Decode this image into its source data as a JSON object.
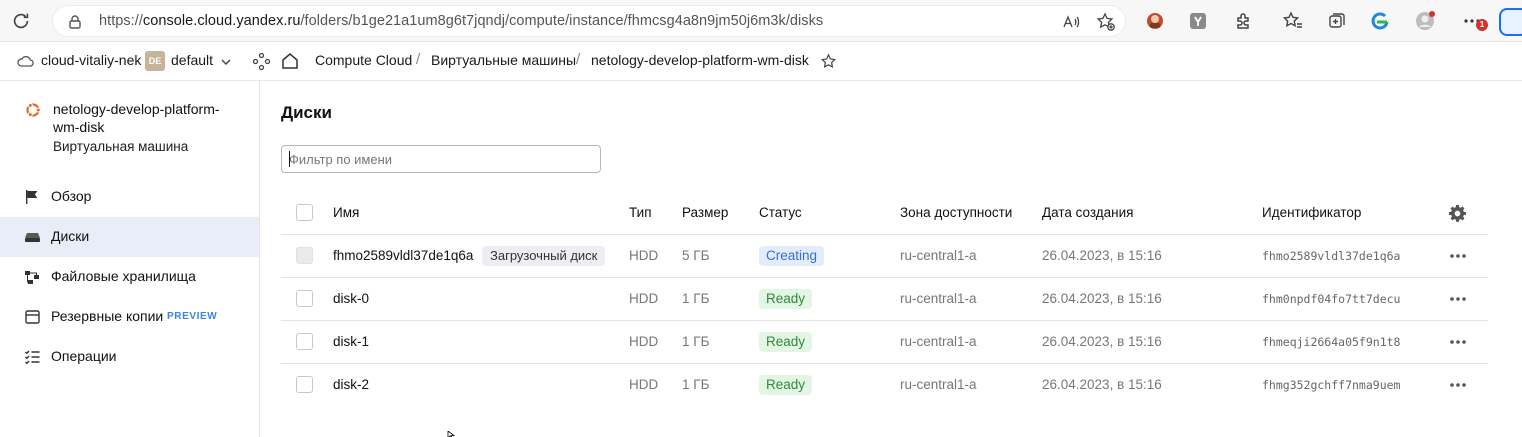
{
  "browser": {
    "url_prefix": "https://",
    "url_host": "console.cloud.yandex.ru",
    "url_path": "/folders/b1ge21a1um8g6t7jqndj/compute/instance/fhmcsg4a8n9jm50j6m3k/disks",
    "notification_count": "1"
  },
  "topnav": {
    "cloud": "cloud-vitaliy-nek",
    "folder_badge": "DE",
    "folder": "default",
    "breadcrumbs": [
      "Compute Cloud",
      "Виртуальные машины",
      "netology-develop-platform-wm-disk"
    ],
    "separator": "/"
  },
  "sidebar": {
    "vm_name": "netology-develop-platform-wm-disk",
    "vm_type": "Виртуальная машина",
    "items": [
      {
        "label": "Обзор",
        "icon": "flag-icon",
        "active": false
      },
      {
        "label": "Диски",
        "icon": "disk-icon",
        "active": true
      },
      {
        "label": "Файловые хранилища",
        "icon": "filestore-icon",
        "active": false
      },
      {
        "label": "Резервные копии",
        "icon": "backup-icon",
        "active": false,
        "badge": "PREVIEW"
      },
      {
        "label": "Операции",
        "icon": "operations-list-icon",
        "active": false
      }
    ]
  },
  "main": {
    "title": "Диски",
    "filter_placeholder": "Фильтр по имени",
    "columns": [
      "Имя",
      "Тип",
      "Размер",
      "Статус",
      "Зона доступности",
      "Дата создания",
      "Идентификатор"
    ],
    "rows": [
      {
        "name": "fhmo2589vldl37de1q6a",
        "tag": "Загрузочный диск",
        "type": "HDD",
        "size": "5 ГБ",
        "status": "Creating",
        "zone": "ru-central1-a",
        "date": "26.04.2023, в 15:16",
        "id": "fhmo2589vldl37de1q6a"
      },
      {
        "name": "disk-0",
        "tag": "",
        "type": "HDD",
        "size": "1 ГБ",
        "status": "Ready",
        "zone": "ru-central1-a",
        "date": "26.04.2023, в 15:16",
        "id": "fhm0npdf04fo7tt7decu"
      },
      {
        "name": "disk-1",
        "tag": "",
        "type": "HDD",
        "size": "1 ГБ",
        "status": "Ready",
        "zone": "ru-central1-a",
        "date": "26.04.2023, в 15:16",
        "id": "fhmeqji2664a05f9n1t8"
      },
      {
        "name": "disk-2",
        "tag": "",
        "type": "HDD",
        "size": "1 ГБ",
        "status": "Ready",
        "zone": "ru-central1-a",
        "date": "26.04.2023, в 15:16",
        "id": "fhmg352gchff7nma9uem"
      }
    ]
  },
  "colors": {
    "accent": "#3c83d9",
    "active_nav": "#e8edf7",
    "status_creating": "#3a6fd0",
    "status_ready": "#2e8b3d",
    "vm_logo": "#e36a2a"
  }
}
